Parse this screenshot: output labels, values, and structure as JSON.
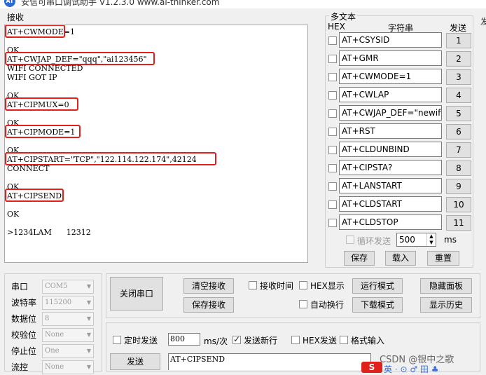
{
  "window": {
    "title": "安信可串口调试助手 V1.2.3.0    www.ai-thinker.com",
    "icon_label": "AT",
    "right_edge_text": "发"
  },
  "receive": {
    "label": "接收",
    "lines": [
      "AT+CWMODE=1",
      "",
      "OK",
      "AT+CWJAP_DEF=\"qqq\",\"ai123456\"",
      "WIFI CONNECTED",
      "WIFI GOT IP",
      "",
      "OK",
      "AT+CIPMUX=0",
      "",
      "OK",
      "AT+CIPMODE=1",
      "",
      "OK",
      "AT+CIPSTART=\"TCP\",\"122.114.122.174\",42124",
      "CONNECT",
      "",
      "OK",
      "AT+CIPSEND",
      "",
      "OK",
      "",
      ">1234LAM      12312"
    ]
  },
  "multi": {
    "title": "多文本",
    "hex_header": "HEX",
    "string_header": "字符串",
    "send_header": "发送",
    "rows": [
      {
        "text": "AT+CSYSID",
        "btn": "1"
      },
      {
        "text": "AT+GMR",
        "btn": "2"
      },
      {
        "text": "AT+CWMODE=1",
        "btn": "3"
      },
      {
        "text": "AT+CWLAP",
        "btn": "4"
      },
      {
        "text": "AT+CWJAP_DEF=\"newifi_",
        "btn": "5"
      },
      {
        "text": "AT+RST",
        "btn": "6"
      },
      {
        "text": "AT+CLDUNBIND",
        "btn": "7"
      },
      {
        "text": "AT+CIPSTA?",
        "btn": "8"
      },
      {
        "text": "AT+LANSTART",
        "btn": "9"
      },
      {
        "text": "AT+CLDSTART",
        "btn": "10"
      },
      {
        "text": "AT+CLDSTOP",
        "btn": "11"
      }
    ],
    "loop_label": "循环发送",
    "loop_value": "500",
    "loop_unit": "ms",
    "save_label": "保存",
    "load_label": "载入",
    "reset_label": "重置"
  },
  "serial": {
    "port_label": "串口",
    "port_value": "COM5",
    "baud_label": "波特率",
    "baud_value": "115200",
    "databits_label": "数据位",
    "databits_value": "8",
    "parity_label": "校验位",
    "parity_value": "None",
    "stopbits_label": "停止位",
    "stopbits_value": "One",
    "flow_label": "流控",
    "flow_value": "None"
  },
  "controls": {
    "close_port": "关闭串口",
    "clear_recv": "清空接收",
    "save_recv": "保存接收",
    "recv_time": "接收时间",
    "hex_display": "HEX显示",
    "auto_wrap": "自动换行",
    "run_mode": "运行模式",
    "download_mode": "下载模式",
    "hide_panel": "隐藏面板",
    "show_history": "显示历史"
  },
  "send": {
    "timed_send": "定时发送",
    "interval_value": "800",
    "interval_unit": "ms/次",
    "send_newline": "发送新行",
    "hex_send": "HEX发送",
    "format_input": "格式输入",
    "send_button": "发送",
    "send_text": "AT+CIPSEND"
  },
  "overlay": {
    "watermark": "CSDN @银中之歌",
    "logo_letter": "S",
    "tray": "英 · ⊙ ♂ 田 ♣"
  },
  "colors": {
    "highlight": "#e0201c"
  }
}
